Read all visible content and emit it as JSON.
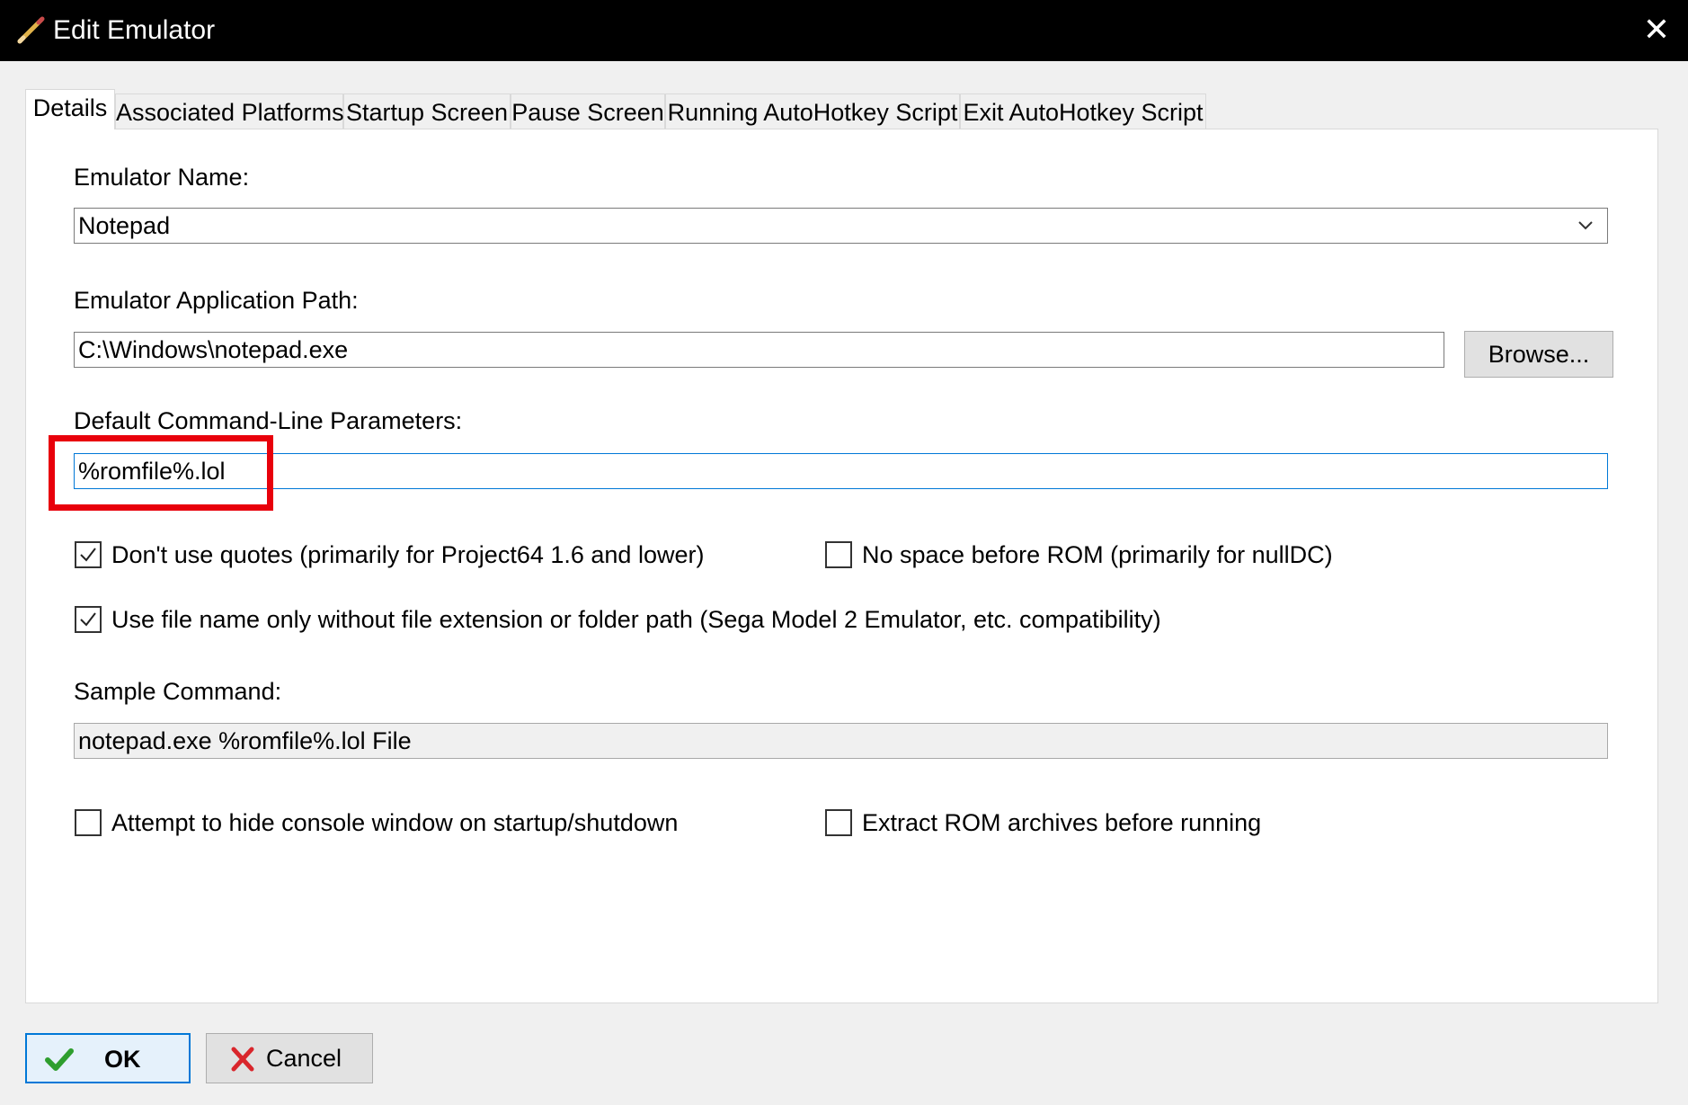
{
  "window": {
    "title": "Edit Emulator",
    "close_glyph": "✕",
    "title_icon": "pencil-icon"
  },
  "tabs": [
    {
      "label": "Details",
      "active": true
    },
    {
      "label": "Associated Platforms",
      "active": false
    },
    {
      "label": "Startup Screen",
      "active": false
    },
    {
      "label": "Pause Screen",
      "active": false
    },
    {
      "label": "Running AutoHotkey Script",
      "active": false
    },
    {
      "label": "Exit AutoHotkey Script",
      "active": false
    }
  ],
  "details": {
    "emulator_name_label": "Emulator Name:",
    "emulator_name_value": "Notepad",
    "app_path_label": "Emulator Application Path:",
    "app_path_value": "C:\\Windows\\notepad.exe",
    "browse_label": "Browse...",
    "cmd_params_label": "Default Command-Line Parameters:",
    "cmd_params_value": "%romfile%.lol",
    "sample_command_label": "Sample Command:",
    "sample_command_value": "notepad.exe %romfile%.lol File"
  },
  "checkboxes": {
    "dont_use_quotes": {
      "label": "Don't use quotes (primarily for Project64 1.6 and lower)",
      "checked": true
    },
    "no_space_before_rom": {
      "label": "No space before ROM (primarily for nullDC)",
      "checked": false
    },
    "use_file_name_only": {
      "label": "Use file name only without file extension or folder path (Sega Model 2 Emulator, etc. compatibility)",
      "checked": true
    },
    "hide_console": {
      "label": "Attempt to hide console window on startup/shutdown",
      "checked": false
    },
    "extract_rom": {
      "label": "Extract ROM archives before running",
      "checked": false
    }
  },
  "footer": {
    "ok_label": "OK",
    "cancel_label": "Cancel"
  },
  "colors": {
    "titlebar": "#000000",
    "highlight": "#e8000b",
    "focus_border": "#0078d7",
    "ok_check": "#2e9e2e",
    "cancel_x": "#d9262c"
  }
}
